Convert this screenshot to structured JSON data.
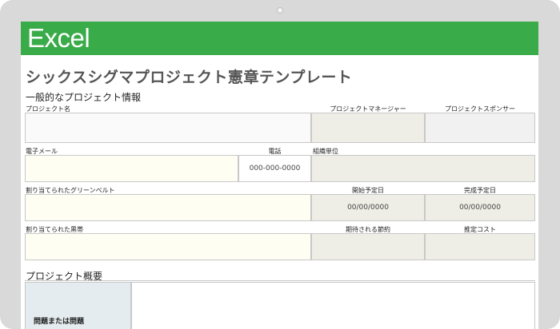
{
  "banner": {
    "app_name": "Excel"
  },
  "document": {
    "title": "シックスシグマプロジェクト憲章テンプレート"
  },
  "general_info": {
    "section_title": "一般的なプロジェクト情報",
    "project_name_label": "プロジェクト名",
    "project_manager_label": "プロジェクトマネージャー",
    "project_sponsor_label": "プロジェクトスポンサー",
    "email_label": "電子メール",
    "phone_label": "電話",
    "phone_value": "000-000-0000",
    "org_unit_label": "組織単位",
    "green_belt_label": "割り当てられたグリーンベルト",
    "start_date_label": "開始予定日",
    "start_date_value": "00/00/0000",
    "end_date_label": "完成予定日",
    "end_date_value": "00/00/0000",
    "black_belt_label": "割り当てられた黒帯",
    "expected_savings_label": "期待される節約",
    "estimated_cost_label": "推定コスト"
  },
  "overview": {
    "section_title": "プロジェクト概要",
    "problem_label": "問題または問題"
  }
}
